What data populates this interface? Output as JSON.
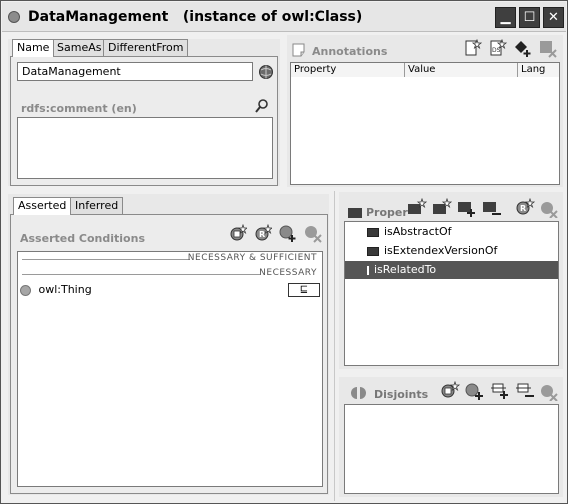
{
  "window": {
    "title": "DataManagement   (instance of owl:Class)",
    "minimize_label": "▁",
    "maximize_label": "☐",
    "close_label": "✕"
  },
  "name_panel": {
    "tabs": [
      "Name",
      "SameAs",
      "DifferentFrom"
    ],
    "name_value": "DataManagement",
    "comment_label": "rdfs:comment (en)"
  },
  "annotations": {
    "title": "Annotations",
    "columns": [
      "Property",
      "Value",
      "Lang"
    ]
  },
  "conditions": {
    "tabs": [
      "Asserted",
      "Inferred"
    ],
    "title": "Asserted Conditions",
    "necessary_sufficient_label": "NECESSARY & SUFFICIENT",
    "necessary_label": "NECESSARY",
    "items": [
      {
        "label": "owl:Thing",
        "badge": "⊑"
      }
    ]
  },
  "properties": {
    "title": "Proper",
    "items": [
      {
        "label": "isAbstractOf",
        "selected": false
      },
      {
        "label": "isExtendexVersionOf",
        "selected": false
      },
      {
        "label": "isRelatedTo",
        "selected": true
      }
    ]
  },
  "disjoints": {
    "title": "Disjoints"
  }
}
